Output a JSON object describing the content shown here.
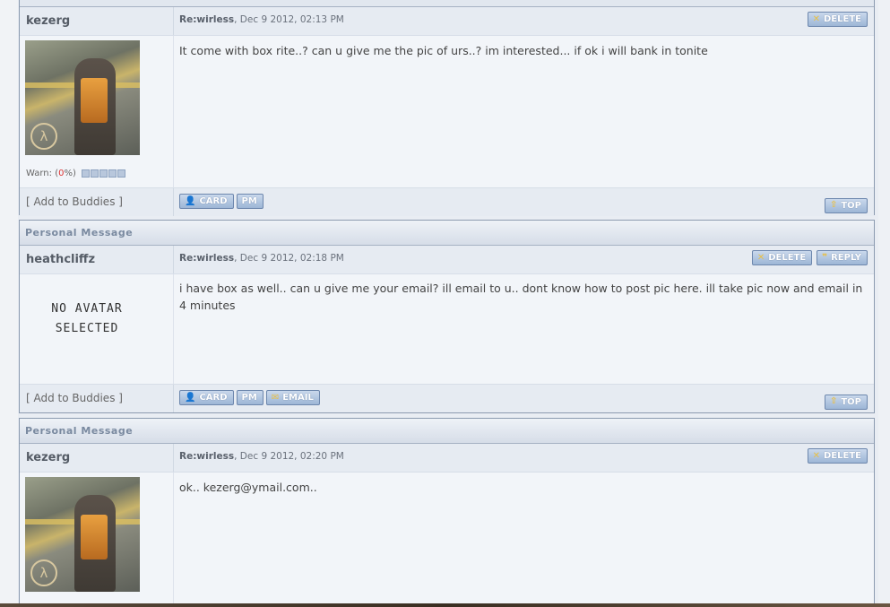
{
  "posts": [
    {
      "author": "kezerg",
      "title": "Re:wirless",
      "date": ", Dec 9 2012, 02:13 PM",
      "message": "It come with box rite..? can u give me the pic of urs..? im interested... if ok i will bank in tonite",
      "warn_label": "Warn: (",
      "warn_value": "0",
      "warn_suffix": "%)",
      "buddies": "[ Add to Buddies ]",
      "buttons": {
        "delete": "DELETE",
        "card": "CARD",
        "pm": "PM",
        "top": "TOP"
      }
    },
    {
      "pm_label": "Personal Message",
      "author": "heathcliffz",
      "title": "Re:wirless",
      "date": ", Dec 9 2012, 02:18 PM",
      "no_avatar_line1": "NO AVATAR",
      "no_avatar_line2": "SELECTED",
      "message": "i have box as well.. can u give me your email? ill email to u.. dont know how to post pic here. ill take pic now and email in 4 minutes",
      "buddies": "[ Add to Buddies ]",
      "buttons": {
        "delete": "DELETE",
        "reply": "REPLY",
        "card": "CARD",
        "pm": "PM",
        "email": "EMAIL",
        "top": "TOP"
      }
    },
    {
      "pm_label": "Personal Message",
      "author": "kezerg",
      "title": "Re:wirless",
      "date": ", Dec 9 2012, 02:20 PM",
      "message": "ok.. kezerg@ymail.com..",
      "buttons": {
        "delete": "DELETE"
      }
    }
  ],
  "colors": {
    "accent": "#9db6d6",
    "border": "#8c9bb0",
    "warn_red": "#dd3333"
  },
  "icons": [
    "delete-x-icon",
    "reply-quote-icon",
    "card-user-icon",
    "email-envelope-icon",
    "top-arrow-icon"
  ]
}
